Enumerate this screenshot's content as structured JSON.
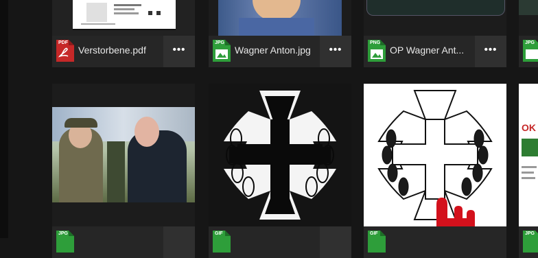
{
  "files": [
    {
      "name": "Verstorbene.pdf",
      "type": "PDF"
    },
    {
      "name": "Wagner Anton.jpg",
      "type": "JPG"
    },
    {
      "name": "OP Wagner Ant...",
      "type": "PNG"
    },
    {
      "name": "",
      "type": "JPG"
    },
    {
      "name": "",
      "type": "JPG"
    },
    {
      "name": "",
      "type": "GIF"
    },
    {
      "name": "",
      "type": "GIF"
    },
    {
      "name": "",
      "type": "JPG"
    }
  ],
  "more_label": "•••",
  "partial_logo_text": "OK",
  "colors": {
    "pdf": "#c62828",
    "img": "#2e9e3a",
    "tile": "#222222",
    "footer": "#262626"
  }
}
